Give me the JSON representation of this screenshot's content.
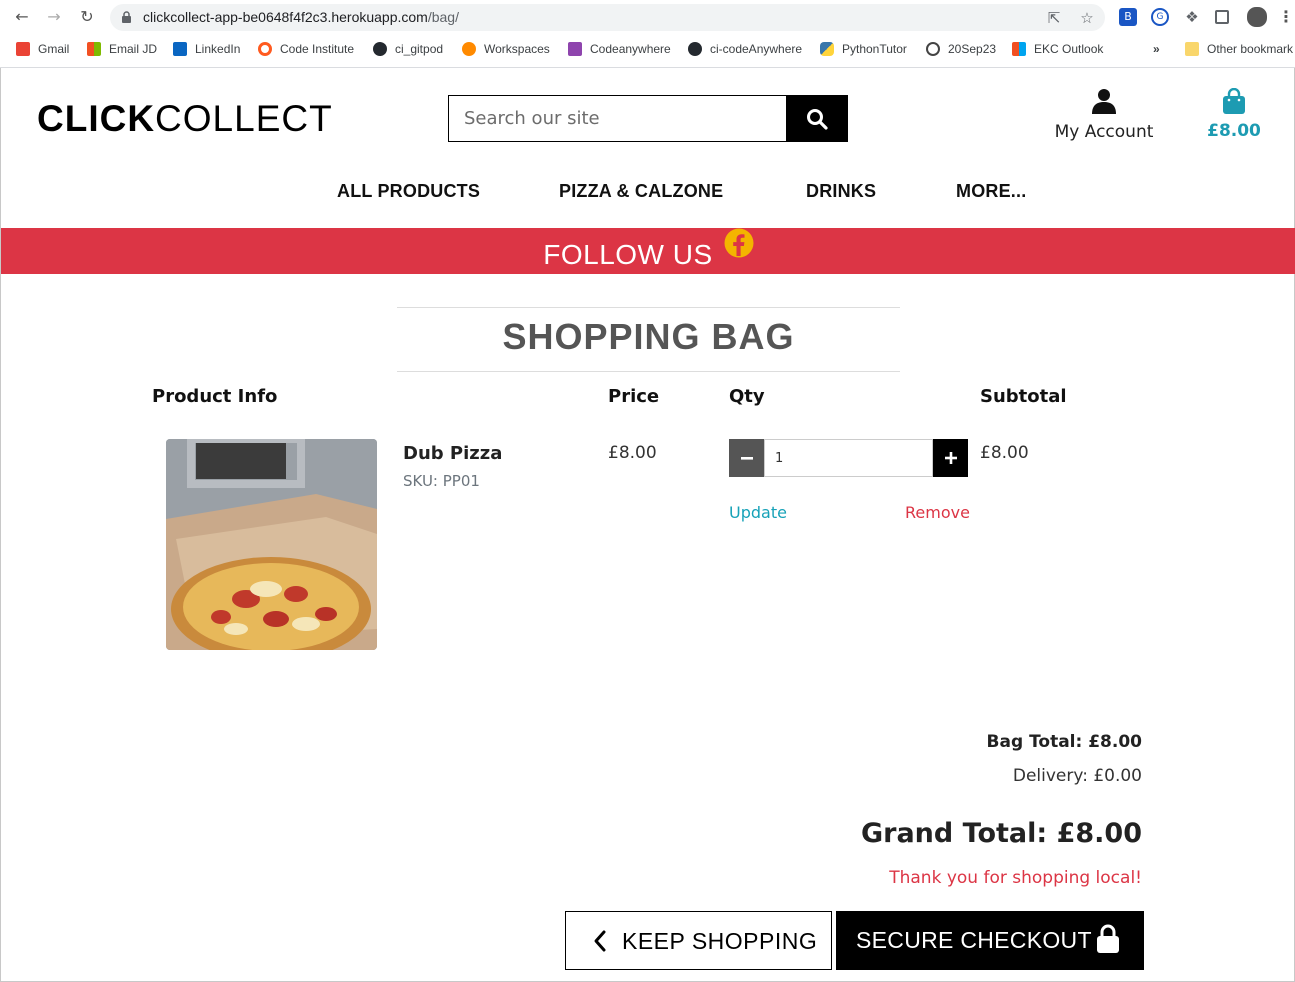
{
  "browser": {
    "url_host": "clickcollect-app-be0648f4f2c3.herokuapp.com",
    "url_path": "/bag/",
    "bookmarks": [
      {
        "label": "Gmail",
        "icon": "gmail-icon",
        "color": "#ea4335"
      },
      {
        "label": "Email JD",
        "icon": "microsoft-icon",
        "color": "#f25022"
      },
      {
        "label": "LinkedIn",
        "icon": "linkedin-icon",
        "color": "#0a66c2"
      },
      {
        "label": "Code Institute",
        "icon": "code-institute-icon",
        "color": "#ff5a1f"
      },
      {
        "label": "ci_gitpod",
        "icon": "github-icon",
        "color": "#24292f"
      },
      {
        "label": "Workspaces",
        "icon": "gitpod-icon",
        "color": "#ff8a00"
      },
      {
        "label": "Codeanywhere",
        "icon": "codeanywhere-icon",
        "color": "#8e44ad"
      },
      {
        "label": "ci-codeAnywhere",
        "icon": "github-icon",
        "color": "#24292f"
      },
      {
        "label": "PythonTutor",
        "icon": "python-icon",
        "color": "#3776ab"
      },
      {
        "label": "20Sep23",
        "icon": "history-icon",
        "color": "#444444"
      },
      {
        "label": "EKC Outlook",
        "icon": "microsoft-icon",
        "color": "#f25022"
      }
    ],
    "overflow_label": "»",
    "other_bookmarks": "Other bookmark"
  },
  "header": {
    "logo_bold": "CLICK",
    "logo_regular": "COLLECT",
    "search_placeholder": "Search our site",
    "account_label": "My Account",
    "bag_total": "£8.00"
  },
  "nav": {
    "items": [
      "ALL PRODUCTS",
      "PIZZA & CALZONE",
      "DRINKS",
      "MORE..."
    ]
  },
  "banner": {
    "text": "FOLLOW US"
  },
  "bag": {
    "title": "SHOPPING BAG",
    "columns": [
      "Product Info",
      "Price",
      "Qty",
      "Subtotal"
    ],
    "item": {
      "name": "Dub Pizza",
      "sku": "SKU: PP01",
      "price": "£8.00",
      "qty": "1",
      "subtotal": "£8.00",
      "update_label": "Update",
      "remove_label": "Remove"
    },
    "bag_total": "Bag Total: £8.00",
    "delivery": "Delivery: £0.00",
    "grand_total": "Grand Total: £8.00",
    "thanks": "Thank you for shopping local!",
    "keep_shopping_label": "KEEP SHOPPING",
    "checkout_label": "SECURE CHECKOUT"
  },
  "colors": {
    "accent_teal": "#1d9bb2",
    "banner_red": "#dc3545",
    "facebook_yellow": "#f4b400"
  }
}
